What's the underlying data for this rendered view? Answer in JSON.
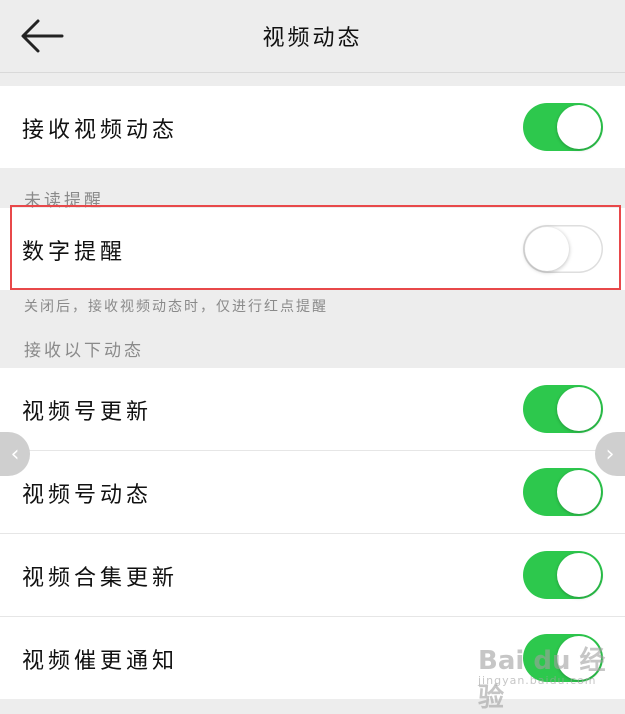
{
  "header": {
    "title": "视频动态"
  },
  "receive_all": {
    "label": "接收视频动态",
    "on": true
  },
  "unread_section": {
    "label": "未读提醒"
  },
  "number_reminder": {
    "label": "数字提醒",
    "on": false
  },
  "hint": "关闭后，接收视频动态时，仅进行红点提醒",
  "receive_section": {
    "label": "接收以下动态"
  },
  "items": [
    {
      "label": "视频号更新",
      "on": true
    },
    {
      "label": "视频号动态",
      "on": true
    },
    {
      "label": "视频合集更新",
      "on": true
    },
    {
      "label": "视频催更通知",
      "on": true
    }
  ],
  "watermark": {
    "brand": "Bai du 经验",
    "sub": "jingyan.baidu.com"
  },
  "colors": {
    "toggle_on": "#2dc84d",
    "highlight": "#e8484a",
    "background": "#ededed"
  },
  "icons": {
    "back": "arrow-left-icon",
    "nav_left": "chevron-left-icon",
    "nav_right": "chevron-right-icon",
    "logo": "baidu-paw-icon"
  }
}
